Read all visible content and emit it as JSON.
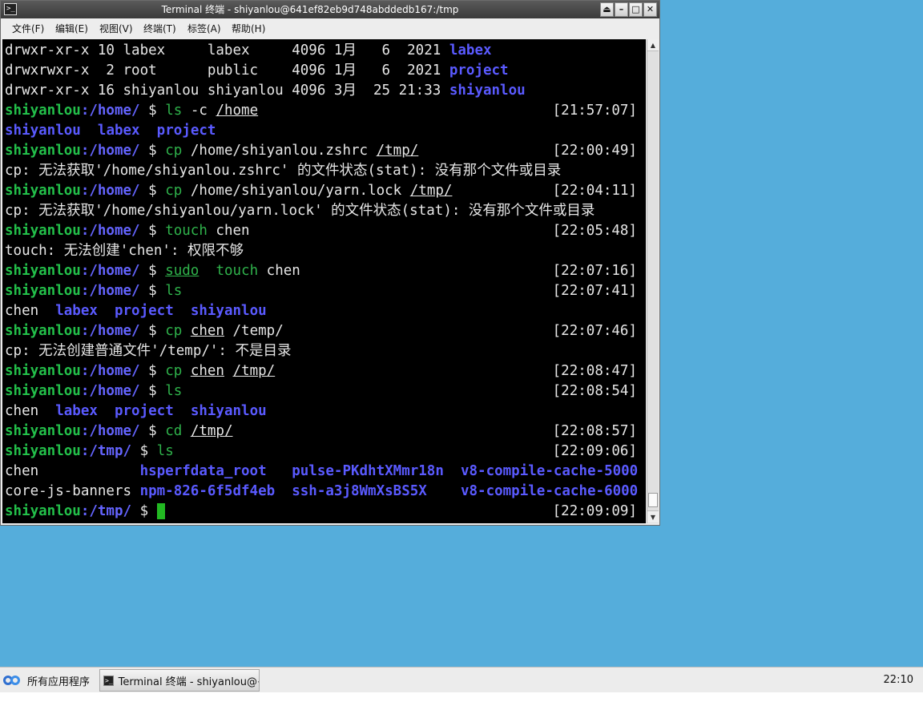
{
  "window": {
    "title": "Terminal 终端 - shiyanlou@641ef82eb9d748abddedb167:/tmp",
    "buttons": {
      "shade": "⏏",
      "minimize": "–",
      "maximize": "□",
      "close": "✕"
    }
  },
  "menu": {
    "items": [
      "文件(F)",
      "编辑(E)",
      "视图(V)",
      "终端(T)",
      "标签(A)",
      "帮助(H)"
    ]
  },
  "terminal": {
    "lines": [
      [
        {
          "t": "drwxr-xr-x 10 labex     labex     4096 1月   6  2021 "
        },
        {
          "t": "labex",
          "c": "c-dirname"
        }
      ],
      [
        {
          "t": "drwxrwxr-x  2 root      public    4096 1月   6  2021 "
        },
        {
          "t": "project",
          "c": "c-dirname"
        }
      ],
      [
        {
          "t": "drwxr-xr-x 16 shiyanlou shiyanlou 4096 3月  25 21:33 "
        },
        {
          "t": "shiyanlou",
          "c": "c-dirname"
        }
      ],
      {
        "ts": "[21:57:07]",
        "s": [
          {
            "t": "shiyanlou",
            "c": "p-user"
          },
          {
            "t": ":/home/",
            "c": "p-dir"
          },
          {
            "t": " $ "
          },
          {
            "t": "ls",
            "c": "c-cmd"
          },
          {
            "t": " -c "
          },
          {
            "t": "/home",
            "c": "c-ul"
          }
        ]
      },
      [
        {
          "t": "shiyanlou",
          "c": "c-dirname"
        },
        {
          "t": "  "
        },
        {
          "t": "labex",
          "c": "c-dirname"
        },
        {
          "t": "  "
        },
        {
          "t": "project",
          "c": "c-dirname"
        }
      ],
      {
        "ts": "[22:00:49]",
        "s": [
          {
            "t": "shiyanlou",
            "c": "p-user"
          },
          {
            "t": ":/home/",
            "c": "p-dir"
          },
          {
            "t": " $ "
          },
          {
            "t": "cp",
            "c": "c-cmd"
          },
          {
            "t": " /home/shiyanlou.zshrc "
          },
          {
            "t": "/tmp/",
            "c": "c-ul"
          }
        ]
      },
      [
        {
          "t": "cp: 无法获取'/home/shiyanlou.zshrc' 的文件状态(stat): 没有那个文件或目录"
        }
      ],
      {
        "ts": "[22:04:11]",
        "s": [
          {
            "t": "shiyanlou",
            "c": "p-user"
          },
          {
            "t": ":/home/",
            "c": "p-dir"
          },
          {
            "t": " $ "
          },
          {
            "t": "cp",
            "c": "c-cmd"
          },
          {
            "t": " /home/shiyanlou/yarn.lock "
          },
          {
            "t": "/tmp/",
            "c": "c-ul"
          }
        ]
      },
      [
        {
          "t": "cp: 无法获取'/home/shiyanlou/yarn.lock' 的文件状态(stat): 没有那个文件或目录"
        }
      ],
      {
        "ts": "[22:05:48]",
        "s": [
          {
            "t": "shiyanlou",
            "c": "p-user"
          },
          {
            "t": ":/home/",
            "c": "p-dir"
          },
          {
            "t": " $ "
          },
          {
            "t": "touch",
            "c": "c-cmd"
          },
          {
            "t": " chen"
          }
        ]
      },
      [
        {
          "t": "touch: 无法创建'chen': 权限不够"
        }
      ],
      {
        "ts": "[22:07:16]",
        "s": [
          {
            "t": "shiyanlou",
            "c": "p-user"
          },
          {
            "t": ":/home/",
            "c": "p-dir"
          },
          {
            "t": " $ "
          },
          {
            "t": "sudo",
            "c": "c-cmd c-ul"
          },
          {
            "t": "  "
          },
          {
            "t": "touch",
            "c": "c-cmd"
          },
          {
            "t": " chen"
          }
        ]
      },
      {
        "ts": "[22:07:41]",
        "s": [
          {
            "t": "shiyanlou",
            "c": "p-user"
          },
          {
            "t": ":/home/",
            "c": "p-dir"
          },
          {
            "t": " $ "
          },
          {
            "t": "ls",
            "c": "c-cmd"
          }
        ]
      },
      [
        {
          "t": "chen  "
        },
        {
          "t": "labex",
          "c": "c-dirname"
        },
        {
          "t": "  "
        },
        {
          "t": "project",
          "c": "c-dirname"
        },
        {
          "t": "  "
        },
        {
          "t": "shiyanlou",
          "c": "c-dirname"
        }
      ],
      {
        "ts": "[22:07:46]",
        "s": [
          {
            "t": "shiyanlou",
            "c": "p-user"
          },
          {
            "t": ":/home/",
            "c": "p-dir"
          },
          {
            "t": " $ "
          },
          {
            "t": "cp",
            "c": "c-cmd"
          },
          {
            "t": " "
          },
          {
            "t": "chen",
            "c": "c-ul"
          },
          {
            "t": " /temp/"
          }
        ]
      },
      [
        {
          "t": "cp: 无法创建普通文件'/temp/': 不是目录"
        }
      ],
      {
        "ts": "[22:08:47]",
        "s": [
          {
            "t": "shiyanlou",
            "c": "p-user"
          },
          {
            "t": ":/home/",
            "c": "p-dir"
          },
          {
            "t": " $ "
          },
          {
            "t": "cp",
            "c": "c-cmd"
          },
          {
            "t": " "
          },
          {
            "t": "chen",
            "c": "c-ul"
          },
          {
            "t": " "
          },
          {
            "t": "/tmp/",
            "c": "c-ul"
          }
        ]
      },
      {
        "ts": "[22:08:54]",
        "s": [
          {
            "t": "shiyanlou",
            "c": "p-user"
          },
          {
            "t": ":/home/",
            "c": "p-dir"
          },
          {
            "t": " $ "
          },
          {
            "t": "ls",
            "c": "c-cmd"
          }
        ]
      },
      [
        {
          "t": "chen  "
        },
        {
          "t": "labex",
          "c": "c-dirname"
        },
        {
          "t": "  "
        },
        {
          "t": "project",
          "c": "c-dirname"
        },
        {
          "t": "  "
        },
        {
          "t": "shiyanlou",
          "c": "c-dirname"
        }
      ],
      {
        "ts": "[22:08:57]",
        "s": [
          {
            "t": "shiyanlou",
            "c": "p-user"
          },
          {
            "t": ":/home/",
            "c": "p-dir"
          },
          {
            "t": " $ "
          },
          {
            "t": "cd",
            "c": "c-cmd"
          },
          {
            "t": " "
          },
          {
            "t": "/tmp/",
            "c": "c-ul"
          }
        ]
      },
      {
        "ts": "[22:09:06]",
        "s": [
          {
            "t": "shiyanlou",
            "c": "p-user"
          },
          {
            "t": ":/tmp/",
            "c": "p-dir"
          },
          {
            "t": " $ "
          },
          {
            "t": "ls",
            "c": "c-cmd"
          }
        ]
      },
      [
        {
          "t": "chen            "
        },
        {
          "t": "hsperfdata_root",
          "c": "c-dirname"
        },
        {
          "t": "   "
        },
        {
          "t": "pulse-PKdhtXMmr18n",
          "c": "c-dirname"
        },
        {
          "t": "  "
        },
        {
          "t": "v8-compile-cache-5000",
          "c": "c-dirname"
        }
      ],
      [
        {
          "t": "core-js-banners "
        },
        {
          "t": "npm-826-6f5df4eb",
          "c": "c-dirname"
        },
        {
          "t": "  "
        },
        {
          "t": "ssh-a3j8WmXsBS5X",
          "c": "c-dirname"
        },
        {
          "t": "    "
        },
        {
          "t": "v8-compile-cache-6000",
          "c": "c-dirname"
        }
      ],
      {
        "ts": "[22:09:09]",
        "cursor": true,
        "s": [
          {
            "t": "shiyanlou",
            "c": "p-user"
          },
          {
            "t": ":/tmp/",
            "c": "p-dir"
          },
          {
            "t": " $ "
          }
        ]
      }
    ]
  },
  "colors": {
    "prompt_user": "#23c04a",
    "prompt_dir": "#6464ff",
    "command": "#2fb24b",
    "directory": "#5a5aff",
    "cursor": "#22b922",
    "desktop": "#55addb"
  },
  "taskbar": {
    "start_label": "所有应用程序",
    "task_label": "Terminal 终端 - shiyanlou@⋯",
    "clock": "22:10"
  },
  "icons": {
    "titlebar": "terminal-icon",
    "start": "applications-menu-icon",
    "task": "terminal-icon"
  }
}
